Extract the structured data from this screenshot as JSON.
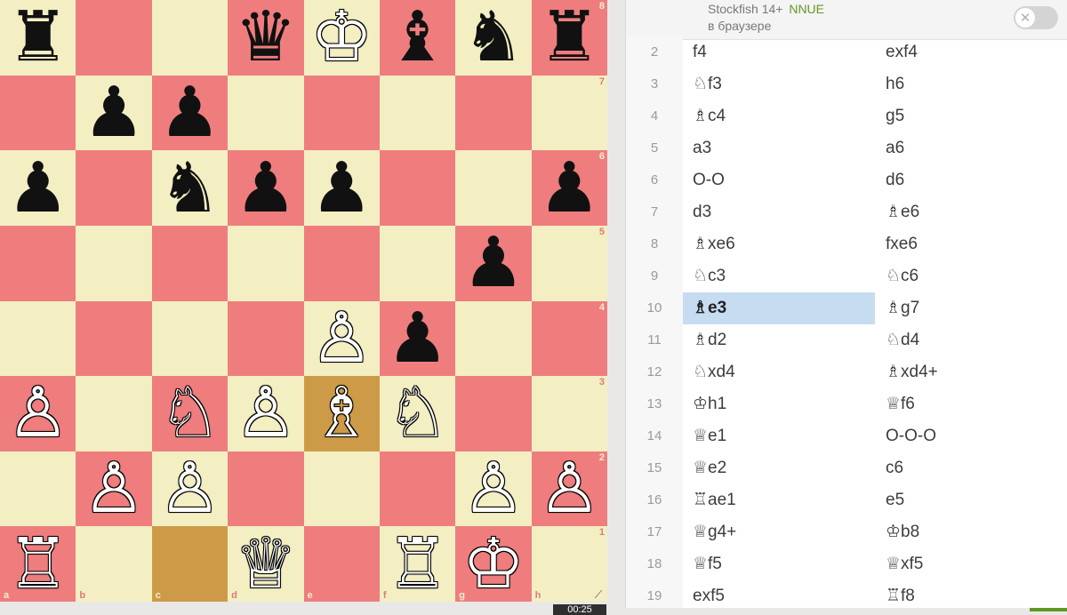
{
  "board": {
    "files": [
      "a",
      "b",
      "c",
      "d",
      "e",
      "f",
      "g",
      "h"
    ],
    "ranks": [
      "8",
      "7",
      "6",
      "5",
      "4",
      "3",
      "2",
      "1"
    ],
    "pieces": [
      {
        "sq": "a8",
        "glyph": "♜",
        "color": "b",
        "name": "black-rook"
      },
      {
        "sq": "d8",
        "glyph": "♛",
        "color": "b",
        "name": "black-queen"
      },
      {
        "sq": "e8",
        "glyph": "♔",
        "color": "w",
        "name": "white-king"
      },
      {
        "sq": "f8",
        "glyph": "♝",
        "color": "b",
        "name": "black-bishop"
      },
      {
        "sq": "g8",
        "glyph": "♞",
        "color": "b",
        "name": "black-knight"
      },
      {
        "sq": "h8",
        "glyph": "♜",
        "color": "b",
        "name": "black-rook"
      },
      {
        "sq": "b7",
        "glyph": "♟",
        "color": "b",
        "name": "black-pawn"
      },
      {
        "sq": "c7",
        "glyph": "♟",
        "color": "b",
        "name": "black-pawn"
      },
      {
        "sq": "a6",
        "glyph": "♟",
        "color": "b",
        "name": "black-pawn"
      },
      {
        "sq": "c6",
        "glyph": "♞",
        "color": "b",
        "name": "black-knight"
      },
      {
        "sq": "d6",
        "glyph": "♟",
        "color": "b",
        "name": "black-pawn"
      },
      {
        "sq": "e6",
        "glyph": "♟",
        "color": "b",
        "name": "black-pawn"
      },
      {
        "sq": "h6",
        "glyph": "♟",
        "color": "b",
        "name": "black-pawn"
      },
      {
        "sq": "g5",
        "glyph": "♟",
        "color": "b",
        "name": "black-pawn"
      },
      {
        "sq": "e4",
        "glyph": "♙",
        "color": "w",
        "name": "white-pawn"
      },
      {
        "sq": "f4",
        "glyph": "♟",
        "color": "b",
        "name": "black-pawn"
      },
      {
        "sq": "a3",
        "glyph": "♙",
        "color": "w",
        "name": "white-pawn"
      },
      {
        "sq": "c3",
        "glyph": "♘",
        "color": "w",
        "name": "white-knight"
      },
      {
        "sq": "d3",
        "glyph": "♙",
        "color": "w",
        "name": "white-pawn"
      },
      {
        "sq": "e3",
        "glyph": "♗",
        "color": "w",
        "name": "white-bishop"
      },
      {
        "sq": "f3",
        "glyph": "♘",
        "color": "w",
        "name": "white-knight"
      },
      {
        "sq": "b2",
        "glyph": "♙",
        "color": "w",
        "name": "white-pawn"
      },
      {
        "sq": "c2",
        "glyph": "♙",
        "color": "w",
        "name": "white-pawn"
      },
      {
        "sq": "g2",
        "glyph": "♙",
        "color": "w",
        "name": "white-pawn"
      },
      {
        "sq": "h2",
        "glyph": "♙",
        "color": "w",
        "name": "white-pawn"
      },
      {
        "sq": "a1",
        "glyph": "♖",
        "color": "w",
        "name": "white-rook"
      },
      {
        "sq": "d1",
        "glyph": "♕",
        "color": "w",
        "name": "white-queen"
      },
      {
        "sq": "f1",
        "glyph": "♖",
        "color": "w",
        "name": "white-rook"
      },
      {
        "sq": "g1",
        "glyph": "♔",
        "color": "w",
        "name": "white-king"
      }
    ],
    "highlighted_squares": [
      "e3",
      "c1"
    ],
    "colors": {
      "light": "#f3efc3",
      "dark": "#ef7d7e",
      "highlight": "#cd9b48"
    }
  },
  "clock": {
    "text": "00:25"
  },
  "engine": {
    "name": "Stockfish 14+",
    "badge": "NNUE",
    "subtitle": "в браузере",
    "toggle_symbol": "✕",
    "enabled": false
  },
  "moves": {
    "active": {
      "row": 10,
      "side": "white"
    },
    "rows": [
      {
        "num": "2",
        "white": "f4",
        "black": "exf4"
      },
      {
        "num": "3",
        "white": "♘f3",
        "black": "h6"
      },
      {
        "num": "4",
        "white": "♗c4",
        "black": "g5"
      },
      {
        "num": "5",
        "white": "a3",
        "black": "a6"
      },
      {
        "num": "6",
        "white": "O-O",
        "black": "d6"
      },
      {
        "num": "7",
        "white": "d3",
        "black": "♗e6"
      },
      {
        "num": "8",
        "white": "♗xe6",
        "black": "fxe6"
      },
      {
        "num": "9",
        "white": "♘c3",
        "black": "♘c6"
      },
      {
        "num": "10",
        "white": "♗e3",
        "black": "♗g7"
      },
      {
        "num": "11",
        "white": "♗d2",
        "black": "♘d4"
      },
      {
        "num": "12",
        "white": "♘xd4",
        "black": "♗xd4+"
      },
      {
        "num": "13",
        "white": "♔h1",
        "black": "♕f6"
      },
      {
        "num": "14",
        "white": "♕e1",
        "black": "O-O-O"
      },
      {
        "num": "15",
        "white": "♕e2",
        "black": "c6"
      },
      {
        "num": "16",
        "white": "♖ae1",
        "black": "e5"
      },
      {
        "num": "17",
        "white": "♕g4+",
        "black": "♔b8"
      },
      {
        "num": "18",
        "white": "♕f5",
        "black": "♕xf5"
      },
      {
        "num": "19",
        "white": "exf5",
        "black": "♖f8"
      }
    ]
  },
  "accent_color": "#629924"
}
